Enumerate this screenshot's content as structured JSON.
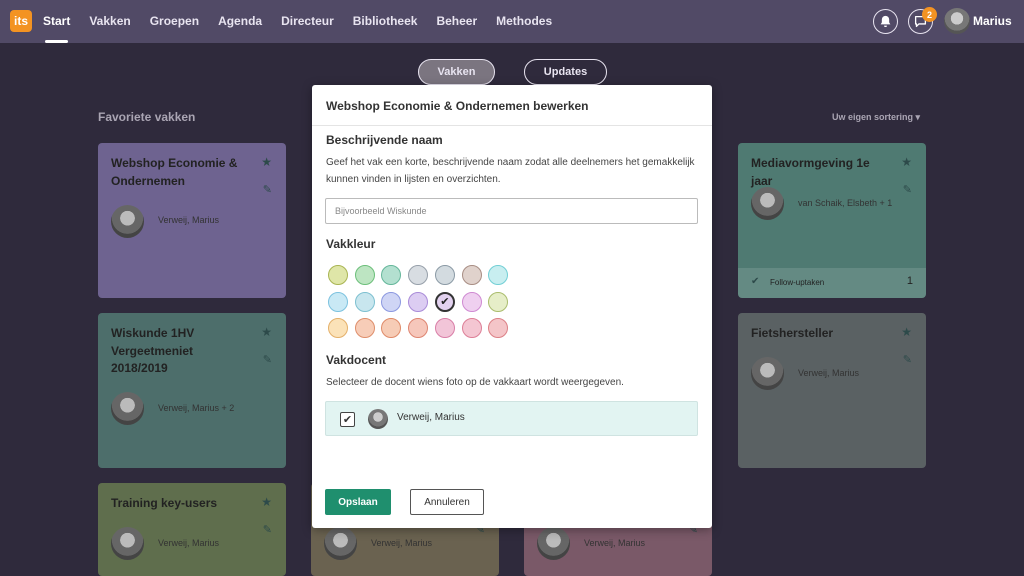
{
  "nav": {
    "logo": "its",
    "items": [
      "Start",
      "Vakken",
      "Groepen",
      "Agenda",
      "Directeur",
      "Bibliotheek",
      "Beheer",
      "Methodes"
    ],
    "notification_count": "2",
    "user_name": "Marius"
  },
  "toggle": {
    "vakken": "Vakken",
    "updates": "Updates"
  },
  "favorites": {
    "title": "Favoriete vakken",
    "sort_label": "Uw eigen sortering"
  },
  "cards": [
    {
      "title": "Webshop Economie & Ondernemen",
      "teacher": "Verweij, Marius",
      "color": "#6e6390"
    },
    {
      "title": "Wiskunde 1HV Vergeetmeniet 2018/2019",
      "teacher": "Verweij, Marius + 2",
      "color": "#4d6e6b"
    },
    {
      "title": "Training key-users",
      "teacher": "Verweij, Marius",
      "color": "#5f6e4d"
    },
    {
      "title": "",
      "teacher": "Verweij, Marius",
      "color": "#6a6250"
    },
    {
      "title": "",
      "teacher": "Verweij, Marius",
      "color": "#7a5968"
    },
    {
      "title": "Mediavormgeving 1e jaar",
      "teacher": "van Schaik, Elsbeth + 1",
      "color": "#4f7a72",
      "footer_label": "Follow-uptaken",
      "footer_count": "1"
    },
    {
      "title": "Fietshersteller",
      "teacher": "Verweij, Marius",
      "color": "#5a6163"
    }
  ],
  "modal": {
    "title": "Webshop Economie & Ondernemen bewerken",
    "name_heading": "Beschrijvende naam",
    "name_help": "Geef het vak een korte, beschrijvende naam zodat alle deelnemers het gemakkelijk kunnen vinden in lijsten en overzichten.",
    "name_placeholder": "Bijvoorbeeld Wiskunde",
    "color_heading": "Vakkleur",
    "colors": [
      [
        "#dfe6a8",
        "#bde5c2",
        "#b3e0d0",
        "#d8dde2",
        "#d3dbe0",
        "#e0d2cc",
        "#c8eef0"
      ],
      [
        "#c9e9f5",
        "#c8e6ee",
        "#cfd5f5",
        "#dccdf2",
        "#e3d2f0",
        "#efd0f0",
        "#e6eec8"
      ],
      [
        "#fbe2b8",
        "#f7cdb8",
        "#f6ccb6",
        "#f6c7bb",
        "#f2c5d8",
        "#f4c6d2",
        "#f4c5c8"
      ]
    ],
    "color_borders": [
      [
        "#a9b553",
        "#6cbf7a",
        "#64b69a",
        "#97a0aa",
        "#8b9aa5",
        "#a88e84",
        "#72cfd5"
      ],
      [
        "#7cc2df",
        "#7dc0d0",
        "#8b98e0",
        "#a98bd8",
        "#9d86c2",
        "#cf8ad2",
        "#aabd6d"
      ],
      [
        "#e4b06a",
        "#de8e6b",
        "#df8a68",
        "#de8571",
        "#d97ea7",
        "#dd7f97",
        "#dc8086"
      ]
    ],
    "selected_color": "#e3d2f0",
    "teacher_heading": "Vakdocent",
    "teacher_help": "Selecteer de docent wiens foto op de vakkaart wordt weergegeven.",
    "teacher_name": "Verweij, Marius",
    "save_label": "Opslaan",
    "cancel_label": "Annuleren"
  }
}
